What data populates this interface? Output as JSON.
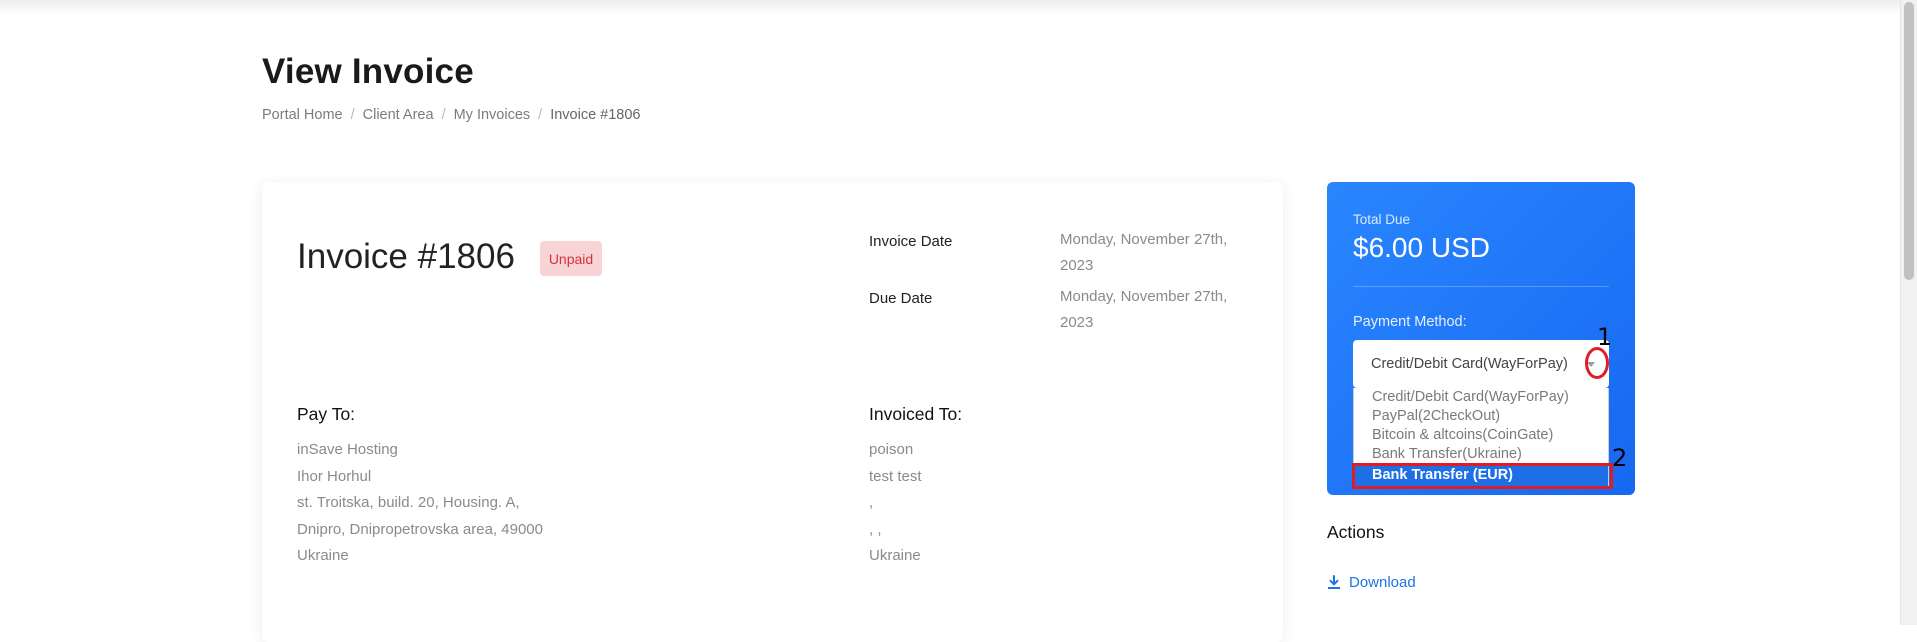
{
  "page": {
    "title": "View Invoice",
    "breadcrumb": [
      "Portal Home",
      "Client Area",
      "My Invoices",
      "Invoice #1806"
    ]
  },
  "invoice": {
    "number_label": "Invoice #1806",
    "status": "Unpaid",
    "invoice_date_label": "Invoice Date",
    "invoice_date_value": "Monday, November 27th, 2023",
    "due_date_label": "Due Date",
    "due_date_value": "Monday, November 27th, 2023",
    "pay_to_heading": "Pay To:",
    "pay_to_lines": [
      "inSave Hosting",
      "Ihor Horhul",
      "st. Troitska, build. 20, Housing. A,",
      "Dnipro, Dnipropetrovska area, 49000",
      "Ukraine"
    ],
    "invoiced_to_heading": "Invoiced To:",
    "invoiced_to_lines": [
      "poison",
      "test test",
      ",",
      ", ,",
      "Ukraine"
    ]
  },
  "summary": {
    "total_due_label": "Total Due",
    "total_due_amount": "$6.00 USD",
    "payment_method_label": "Payment Method:",
    "selected_method": "Credit/Debit Card(WayForPay)",
    "options": [
      "Credit/Debit Card(WayForPay)",
      "PayPal(2CheckOut)",
      "Bitcoin & altcoins(CoinGate)",
      "Bank Transfer(Ukraine)",
      "Bank Transfer (EUR)"
    ],
    "highlighted_option_index": 4
  },
  "annotations": {
    "marker_1": "1",
    "marker_2": "2",
    "color": "#e11b22"
  },
  "actions": {
    "heading": "Actions",
    "download_label": "Download"
  },
  "colors": {
    "accent": "#1b74e4",
    "panel": "#1e6fe6",
    "unpaid_bg": "#f8d4d6",
    "unpaid_text": "#d5323d"
  }
}
